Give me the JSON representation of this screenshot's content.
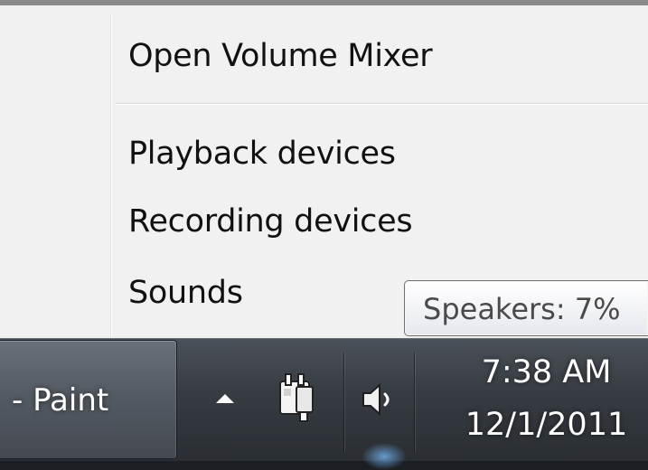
{
  "menu": {
    "items": [
      {
        "label": "Open Volume Mixer"
      },
      {
        "label": "Playback devices"
      },
      {
        "label": "Recording devices"
      },
      {
        "label": "Sounds"
      }
    ]
  },
  "tooltip": {
    "text": "Speakers: 7%"
  },
  "taskbar": {
    "task_button_label": "- Paint",
    "tray": {
      "icons": [
        "show-hidden-icons-arrow-icon",
        "power-plug-icon",
        "speaker-volume-icon"
      ]
    },
    "clock": {
      "time": "7:38 AM",
      "date": "12/1/2011"
    }
  },
  "colors": {
    "menu_background": "#f1f1f1",
    "taskbar_background": "#373c42",
    "text_dark": "#111111",
    "text_light": "#ffffff"
  }
}
